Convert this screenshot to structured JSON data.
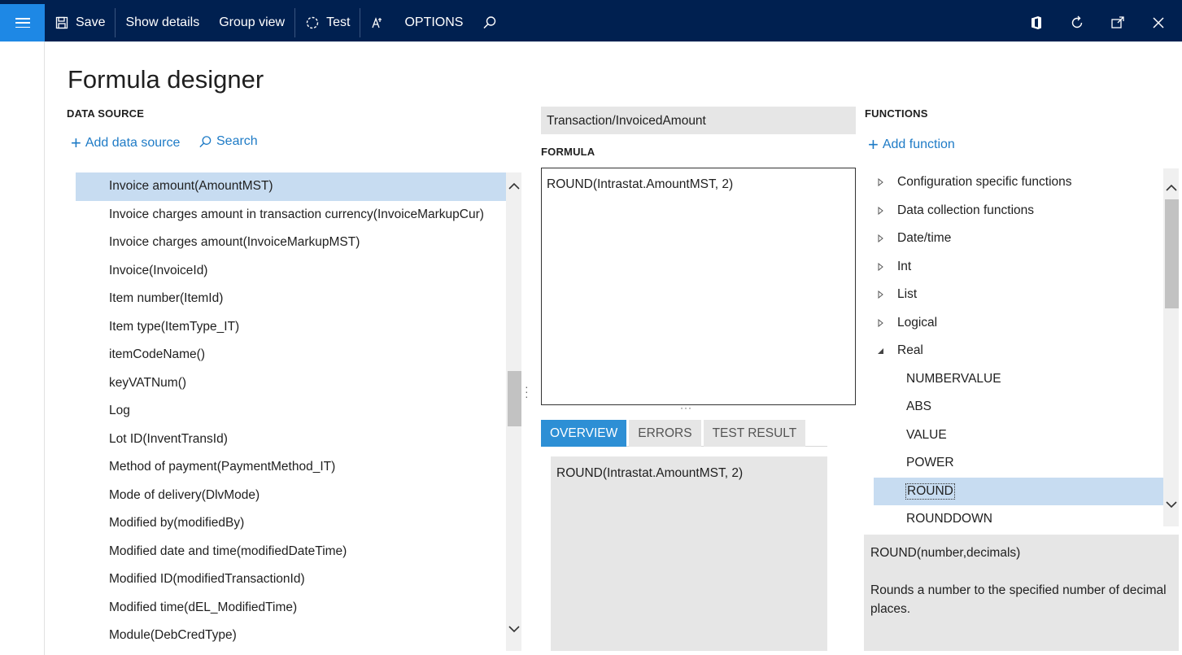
{
  "topbar": {
    "save_label": "Save",
    "show_details_label": "Show details",
    "group_view_label": "Group view",
    "test_label": "Test",
    "options_label": "OPTIONS"
  },
  "page_title": "Formula designer",
  "data_source": {
    "heading": "DATA SOURCE",
    "add_label": "Add data source",
    "search_label": "Search",
    "items": [
      {
        "label": "Invoice amount(AmountMST)",
        "selected": true
      },
      {
        "label": "Invoice charges amount in transaction currency(InvoiceMarkupCur)"
      },
      {
        "label": "Invoice charges amount(InvoiceMarkupMST)"
      },
      {
        "label": "Invoice(InvoiceId)"
      },
      {
        "label": "Item number(ItemId)"
      },
      {
        "label": "Item type(ItemType_IT)"
      },
      {
        "label": "itemCodeName()"
      },
      {
        "label": "keyVATNum()"
      },
      {
        "label": "Log"
      },
      {
        "label": "Lot ID(InventTransId)"
      },
      {
        "label": "Method of payment(PaymentMethod_IT)"
      },
      {
        "label": "Mode of delivery(DlvMode)"
      },
      {
        "label": "Modified by(modifiedBy)"
      },
      {
        "label": "Modified date and time(modifiedDateTime)"
      },
      {
        "label": "Modified ID(modifiedTransactionId)"
      },
      {
        "label": "Modified time(dEL_ModifiedTime)"
      },
      {
        "label": "Module(DebCredType)"
      }
    ]
  },
  "formula": {
    "path": "Transaction/InvoicedAmount",
    "heading": "FORMULA",
    "text": "ROUND(Intrastat.AmountMST, 2)"
  },
  "tabs": [
    {
      "label": "OVERVIEW",
      "active": true
    },
    {
      "label": "ERRORS"
    },
    {
      "label": "TEST RESULT"
    }
  ],
  "overview_text": "ROUND(Intrastat.AmountMST, 2)",
  "functions": {
    "heading": "FUNCTIONS",
    "add_label": "Add function",
    "items": [
      {
        "label": "Configuration specific functions",
        "type": "group",
        "expanded": false
      },
      {
        "label": "Data collection functions",
        "type": "group",
        "expanded": false
      },
      {
        "label": "Date/time",
        "type": "group",
        "expanded": false
      },
      {
        "label": "Int",
        "type": "group",
        "expanded": false
      },
      {
        "label": "List",
        "type": "group",
        "expanded": false
      },
      {
        "label": "Logical",
        "type": "group",
        "expanded": false
      },
      {
        "label": "Real",
        "type": "group",
        "expanded": true
      },
      {
        "label": "NUMBERVALUE",
        "type": "child"
      },
      {
        "label": "ABS",
        "type": "child"
      },
      {
        "label": "VALUE",
        "type": "child"
      },
      {
        "label": "POWER",
        "type": "child"
      },
      {
        "label": "ROUND",
        "type": "child",
        "selected": true
      },
      {
        "label": "ROUNDDOWN",
        "type": "child"
      }
    ],
    "signature": "ROUND(number,decimals)",
    "description": "Rounds a number to the specified number of decimal places."
  },
  "colors": {
    "topbar": "#002050",
    "accent": "#1e88e5",
    "selection": "#c7dcf1",
    "link": "#1e7bc6"
  }
}
